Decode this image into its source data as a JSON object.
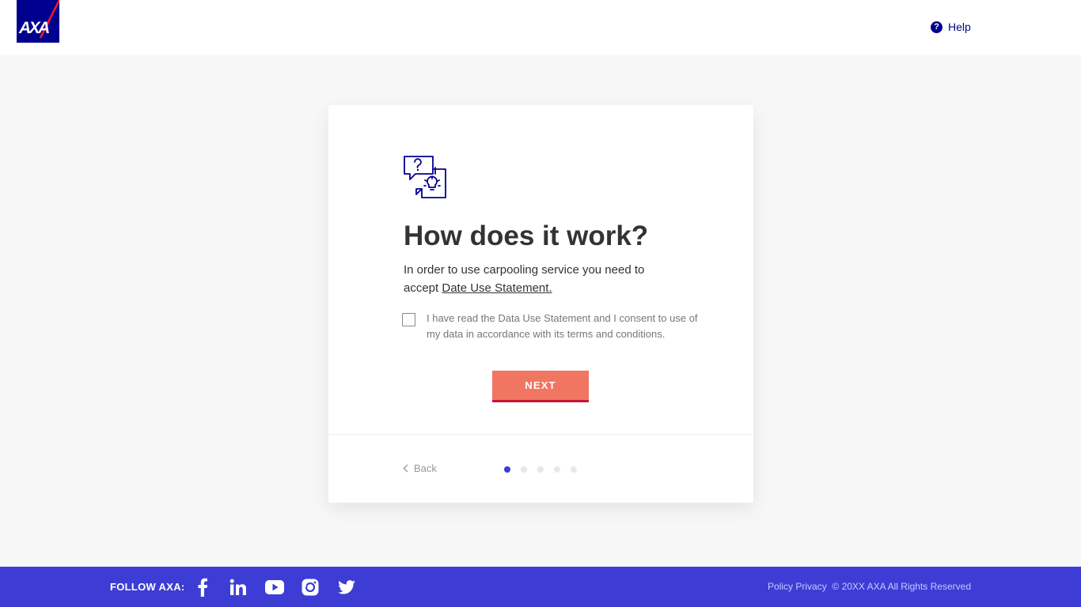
{
  "header": {
    "logo_text": "AXA",
    "help_label": "Help"
  },
  "card": {
    "title": "How does it work?",
    "description_text": "In order to use carpooling service you need to accept ",
    "description_link": "Date Use Statement.",
    "consent_text": "I have read the Data Use Statement and I consent to use of my data in accordance with its terms and conditions.",
    "consent_checked": false,
    "next_label": "NEXT",
    "back_label": "Back",
    "steps_total": 5,
    "current_step": 1
  },
  "footer": {
    "follow_label": "FOLLOW AXA:",
    "social": [
      "facebook-icon",
      "linkedin-icon",
      "youtube-icon",
      "instagram-icon",
      "twitter-icon"
    ],
    "policy_label": "Policy Privacy",
    "copyright": "© 20XX AXA All Rights Reserved"
  },
  "colors": {
    "brand_blue": "#00008f",
    "footer_blue": "#3d3dd6",
    "next_button": "#f07662",
    "active_dot": "#3d3dd6"
  }
}
